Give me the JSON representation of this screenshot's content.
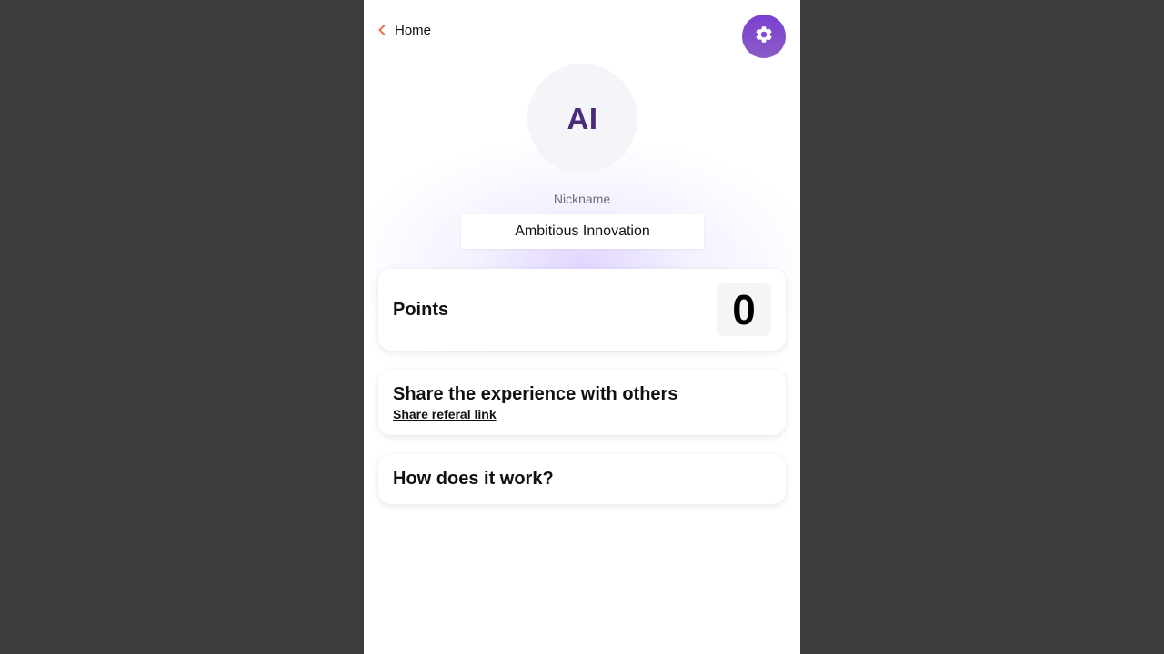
{
  "nav": {
    "back_label": "Home",
    "back_icon": "chevron-left-icon",
    "settings_icon": "gear-icon"
  },
  "profile": {
    "initials": "AI",
    "nickname_label": "Nickname",
    "nickname_value": "Ambitious Innovation"
  },
  "points": {
    "label": "Points",
    "value": "0"
  },
  "share": {
    "title": "Share the experience with others",
    "link_label": "Share referal link"
  },
  "how": {
    "title": "How does it work?"
  },
  "colors": {
    "accent": "#7a3fd0",
    "back_chevron": "#e8734a",
    "initials": "#4a2a7a",
    "page_background": "#3d3d3d"
  }
}
